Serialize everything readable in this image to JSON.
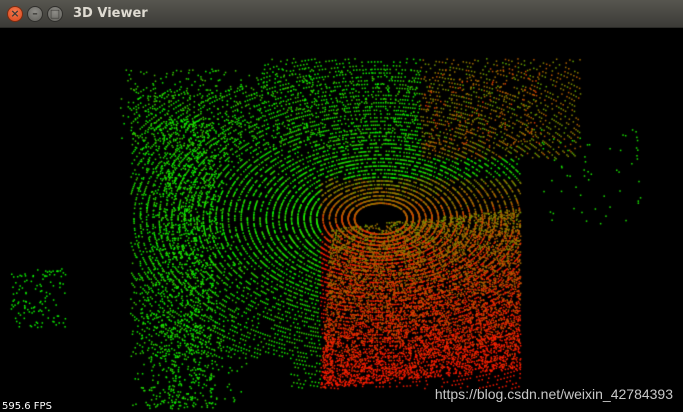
{
  "window": {
    "title": "3D Viewer",
    "close_glyph": "×",
    "minimize_glyph": "–",
    "maximize_glyph": "□"
  },
  "viewport": {
    "fps_label": "595.6 FPS",
    "background_color": "#000000",
    "point_colors": {
      "near": "#00ff00",
      "far": "#ff0000"
    }
  },
  "watermark": {
    "text": "https://blog.csdn.net/weixin_42784393"
  }
}
